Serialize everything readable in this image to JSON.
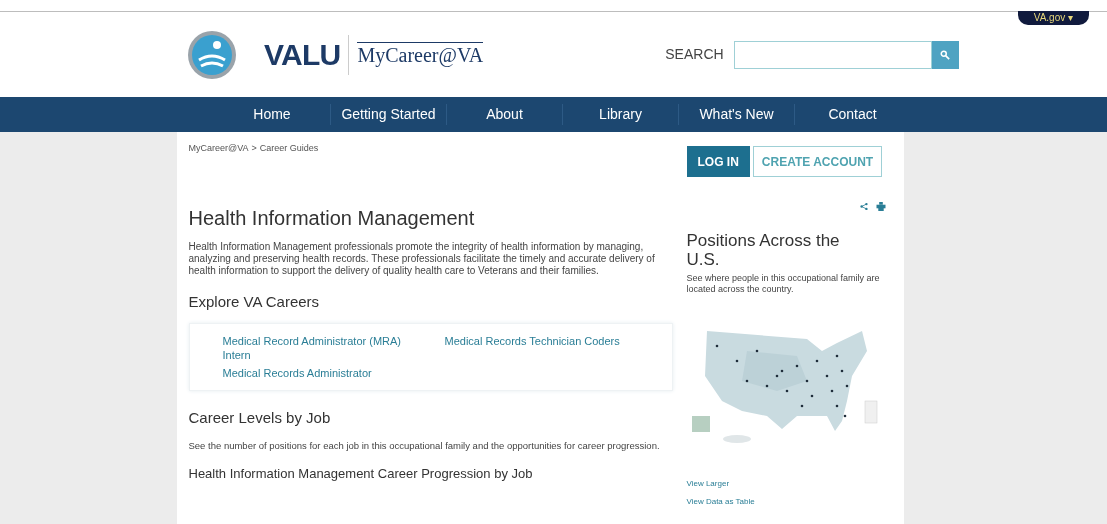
{
  "top_bar": {
    "site_menu": {
      "label": "VA.gov",
      "icon": "▾"
    }
  },
  "header": {
    "logo": {
      "wordmark": "VALU",
      "product": "MyCareer@VA"
    },
    "search": {
      "label": "SEARCH"
    }
  },
  "nav": [
    {
      "label": "Home"
    },
    {
      "label": "Getting Started"
    },
    {
      "label": "About"
    },
    {
      "label": "Library"
    },
    {
      "label": "What's New"
    },
    {
      "label": "Contact"
    }
  ],
  "breadcrumb": {
    "separator": ">",
    "items": [
      {
        "label": "MyCareer@VA"
      },
      {
        "label": "Career Guides"
      }
    ]
  },
  "account_buttons": [
    {
      "label": "LOG IN",
      "kind": "primary"
    },
    {
      "label": "CREATE ACCOUNT",
      "kind": "outline"
    }
  ],
  "main": {
    "title": "Health Information Management",
    "intro": "Health Information Management professionals promote the integrity of health information by managing, analyzing and preserving health records. These professionals facilitate the timely and accurate delivery of health information to support the delivery of quality health care to Veterans and their families.",
    "explore": {
      "heading": "Explore VA Careers",
      "links": [
        {
          "label": "Medical Record Administrator (MRA) Intern"
        },
        {
          "label": "Medical Records Technician Coders"
        },
        {
          "label": "Medical Records Administrator"
        }
      ]
    },
    "career_levels": {
      "heading": "Career Levels by Job",
      "text": "See the number of positions for each job in this occupational family and the opportunities for career progression."
    },
    "progression_heading": "Health Information Management Career Progression by Job"
  },
  "sidebar": {
    "heading": "Positions Across the U.S.",
    "text": "See where people in this occupational family are located across the country.",
    "links": [
      {
        "label": "View Larger"
      },
      {
        "label": "View Data as Table"
      }
    ]
  }
}
